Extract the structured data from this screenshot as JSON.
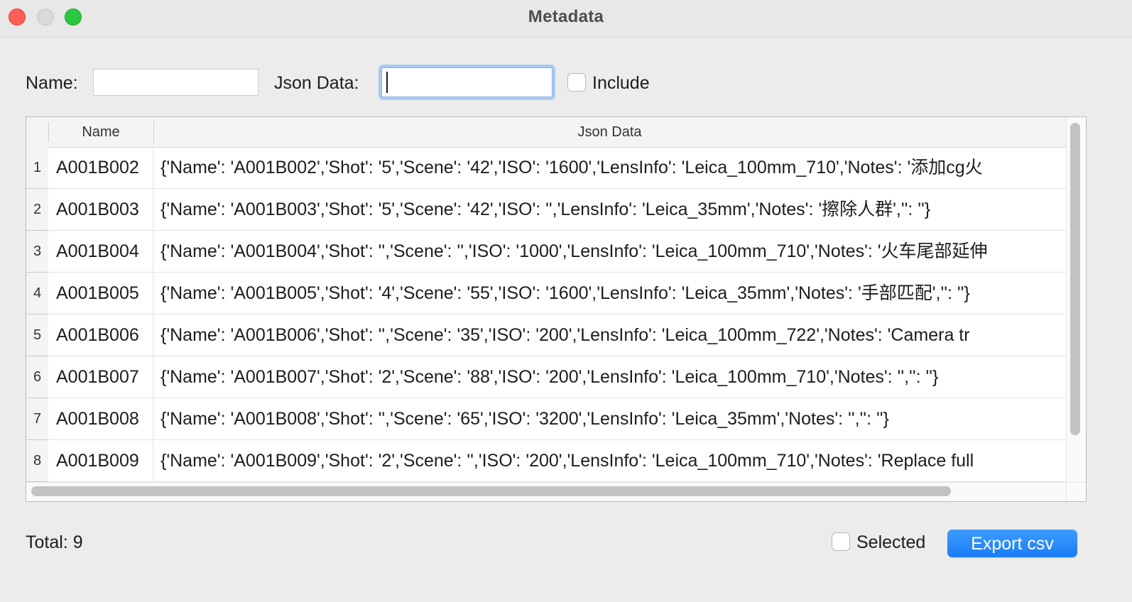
{
  "window": {
    "title": "Metadata"
  },
  "filters": {
    "name_label": "Name:",
    "name_value": "",
    "json_label": "Json Data:",
    "json_value": "",
    "include_label": "Include",
    "include_checked": false
  },
  "table": {
    "columns": [
      "Name",
      "Json Data"
    ],
    "rows": [
      {
        "num": "1",
        "name": "A001B002",
        "json": "{'Name': 'A001B002','Shot': '5','Scene': '42','ISO': '1600','LensInfo': 'Leica_100mm_710','Notes': '添加cg火"
      },
      {
        "num": "2",
        "name": "A001B003",
        "json": "{'Name': 'A001B003','Shot': '5','Scene': '42','ISO': '','LensInfo': 'Leica_35mm','Notes': '擦除人群','': ''}"
      },
      {
        "num": "3",
        "name": "A001B004",
        "json": "{'Name': 'A001B004','Shot': '','Scene': '','ISO': '1000','LensInfo': 'Leica_100mm_710','Notes': '火车尾部延伸"
      },
      {
        "num": "4",
        "name": "A001B005",
        "json": "{'Name': 'A001B005','Shot': '4','Scene': '55','ISO': '1600','LensInfo': 'Leica_35mm','Notes': '手部匹配','': ''}"
      },
      {
        "num": "5",
        "name": "A001B006",
        "json": "{'Name': 'A001B006','Shot': '','Scene': '35','ISO': '200','LensInfo': 'Leica_100mm_722','Notes': 'Camera tr"
      },
      {
        "num": "6",
        "name": "A001B007",
        "json": "{'Name': 'A001B007','Shot': '2','Scene': '88','ISO': '200','LensInfo': 'Leica_100mm_710','Notes': '','': ''}"
      },
      {
        "num": "7",
        "name": "A001B008",
        "json": "{'Name': 'A001B008','Shot': '','Scene': '65','ISO': '3200','LensInfo': 'Leica_35mm','Notes': '','': ''}"
      },
      {
        "num": "8",
        "name": "A001B009",
        "json": "{'Name': 'A001B009','Shot': '2','Scene': '','ISO': '200','LensInfo': 'Leica_100mm_710','Notes': 'Replace full"
      }
    ]
  },
  "footer": {
    "total_label": "Total: 9",
    "selected_label": "Selected",
    "selected_checked": false,
    "export_label": "Export csv"
  },
  "colors": {
    "accent": "#1a7cf5",
    "close": "#fe5f57",
    "zoom": "#28c840",
    "focus_ring": "#a9c8f3"
  }
}
